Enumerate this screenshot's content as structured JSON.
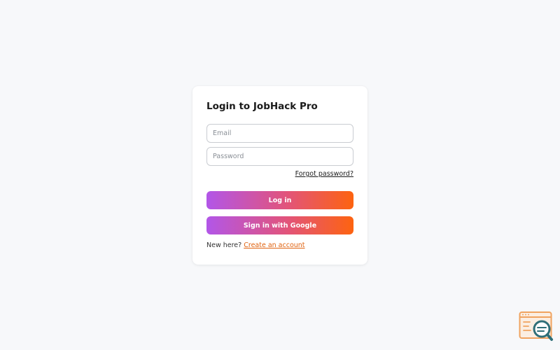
{
  "login": {
    "title": "Login to JobHack Pro",
    "email_placeholder": "Email",
    "password_placeholder": "Password",
    "forgot_label": "Forgot password?",
    "login_label": "Log in",
    "google_label": "Sign in with Google",
    "new_here_text": "New here?",
    "create_account_label": "Create an account"
  },
  "colors": {
    "page_background": "#f7f8fa",
    "gradient_start": "#b256e8",
    "gradient_end": "#fd6310",
    "link_accent": "#e0620f"
  },
  "icons": {
    "corner": "window-search-icon"
  }
}
